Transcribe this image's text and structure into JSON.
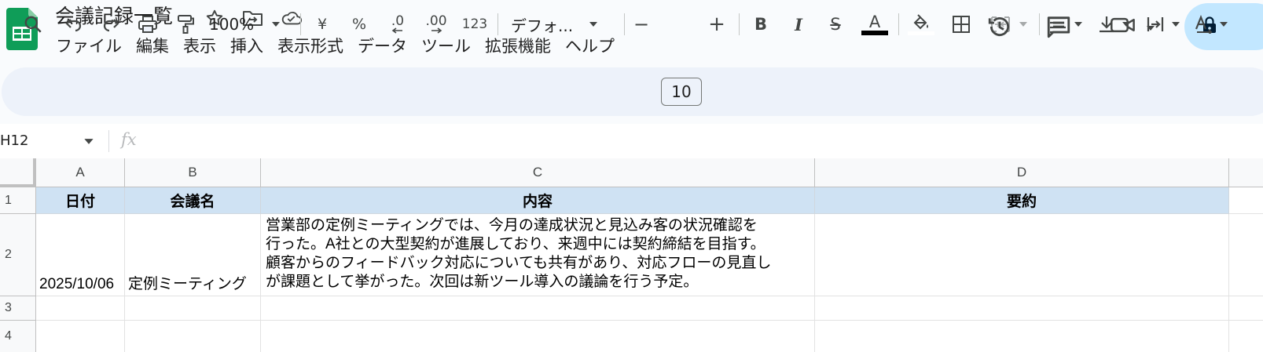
{
  "header": {
    "title": "会議記録一覧",
    "menu": [
      "ファイル",
      "編集",
      "表示",
      "挿入",
      "表示形式",
      "データ",
      "ツール",
      "拡張機能",
      "ヘルプ"
    ],
    "icons": [
      "sheets-logo-icon",
      "star-icon",
      "move-to-folder-icon",
      "cloud-saved-icon",
      "version-history-icon",
      "comments-icon",
      "meet-video-icon",
      "lock-icon"
    ]
  },
  "toolbar": {
    "zoom": "100%",
    "currency": "¥",
    "percent": "%",
    "decrease_decimal": ".0",
    "increase_decimal": ".00",
    "number_format": "123",
    "font": "デフォ...",
    "font_size": "10",
    "minus": "−",
    "plus": "+",
    "bold": "B",
    "italic": "I",
    "strike": "S",
    "text_color_glyph": "A",
    "text_color": "#000000",
    "fill_color": "#ffffff"
  },
  "formula_bar": {
    "name_box": "H12",
    "fx": "fx",
    "content": ""
  },
  "grid": {
    "columns": [
      "A",
      "B",
      "C",
      "D"
    ],
    "rows": [
      "1",
      "2",
      "3",
      "4"
    ],
    "cells": {
      "A1": "日付",
      "B1": "会議名",
      "C1": "内容",
      "D1": "要約",
      "A2": "2025/10/06",
      "B2": "定例ミーティング",
      "C2_lines": [
        "営業部の定例ミーティングでは、今月の達成状況と見込み客の状況確認を",
        "行った。A社との大型契約が進展しており、来週中には契約締結を目指す。",
        "顧客からのフィードバック対応についても共有があり、対応フローの見直し",
        "が課題として挙がった。次回は新ツール導入の議論を行う予定。"
      ],
      "D2": ""
    },
    "header_fill": "#cfe2f3"
  },
  "colors": {
    "accent": "#0b57d0",
    "share_button": "#c2e7ff",
    "toolbar_bg": "#edf2fa",
    "sheets_green": "#0f9d58"
  }
}
